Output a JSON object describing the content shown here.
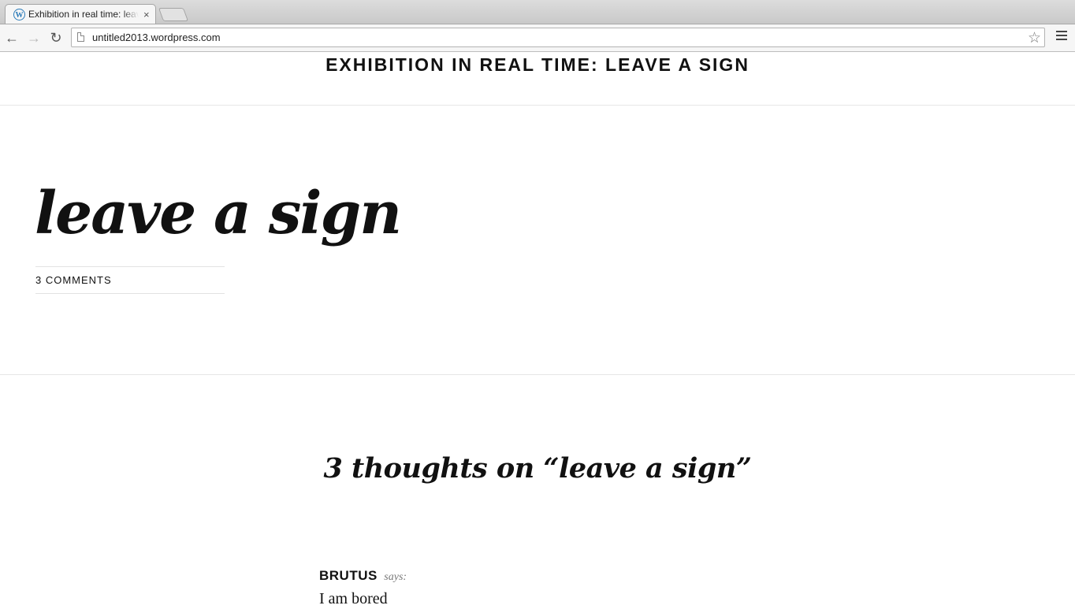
{
  "browser": {
    "tab_title": "Exhibition in real time: leave a sign",
    "tab_close": "×",
    "url": "untitled2013.wordpress.com",
    "icons": [
      "back-icon",
      "forward-icon",
      "reload-icon",
      "page-icon",
      "star-icon",
      "menu-icon"
    ]
  },
  "site": {
    "title": "EXHIBITION IN REAL TIME: LEAVE A SIGN"
  },
  "post": {
    "title": "leave a sign",
    "comments_link": "3 COMMENTS"
  },
  "comments": {
    "heading": "3 thoughts on “leave a sign”",
    "items": [
      {
        "author": "BRUTUS",
        "says": "says:",
        "text": "I am bored"
      }
    ]
  }
}
